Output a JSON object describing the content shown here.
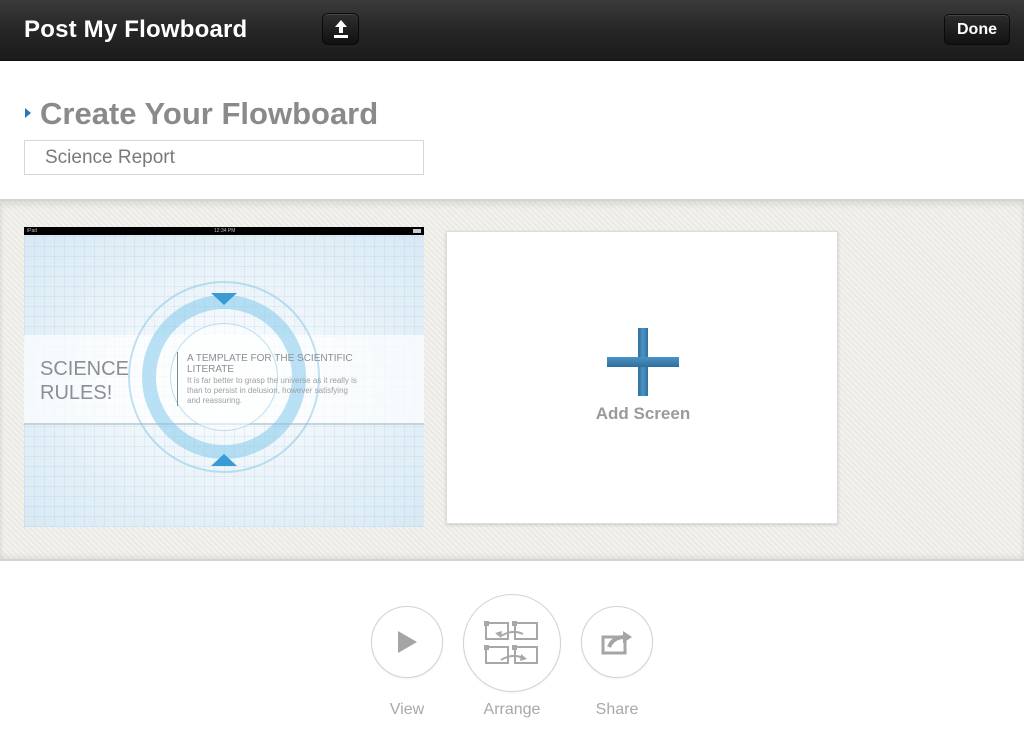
{
  "topbar": {
    "title": "Post My Flowboard",
    "upload_icon": "upload-icon",
    "done_label": "Done"
  },
  "header": {
    "section_title": "Create Your Flowboard",
    "name_value": "Science Report",
    "name_placeholder": ""
  },
  "screens": [
    {
      "status_left": "iPad",
      "status_center": "12:34 PM",
      "headline": "SCIENCE RULES!",
      "subhead": "A TEMPLATE FOR THE SCIENTIFIC LITERATE",
      "body": "It is far better to grasp the universe as it really is than to persist in delusion, however satisfying and reassuring."
    }
  ],
  "add_screen": {
    "label": "Add Screen",
    "icon": "plus-icon"
  },
  "toolbar": {
    "view_label": "View",
    "arrange_label": "Arrange",
    "share_label": "Share"
  },
  "colors": {
    "accent": "#2b79b8",
    "topbar": "#262626",
    "canvas": "#efede8",
    "muted_text": "#8a8a8a"
  }
}
